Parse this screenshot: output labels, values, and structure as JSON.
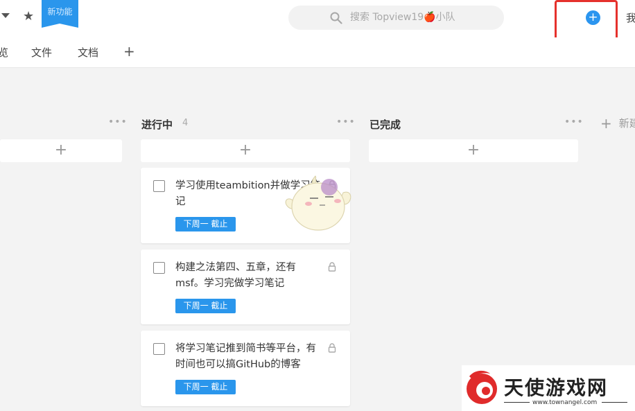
{
  "header": {
    "new_feature_ribbon": "新功能",
    "search_placeholder": "搜索 Topview19🍎小队",
    "me_label": "我"
  },
  "tabs": [
    {
      "label": "览"
    },
    {
      "label": "文件"
    },
    {
      "label": "文档"
    }
  ],
  "columns": [
    {
      "title": "进行中",
      "count": "4"
    },
    {
      "title": "已完成"
    }
  ],
  "new_column_label": "新建",
  "tasks": [
    {
      "title": "学习使用teambition并做学习笔记",
      "tag": "下周一 截止"
    },
    {
      "title": "构建之法第四、五章，还有msf。学习完做学习笔记",
      "tag": "下周一 截止"
    },
    {
      "title": "将学习笔记推到简书等平台，有时间也可以搞GitHub的博客",
      "tag": "下周一 截止"
    }
  ],
  "watermark": {
    "brand": "天使游戏网",
    "url": "www.townangel.com"
  },
  "colors": {
    "accent": "#2a96ec",
    "highlight_box": "#e5312c"
  }
}
